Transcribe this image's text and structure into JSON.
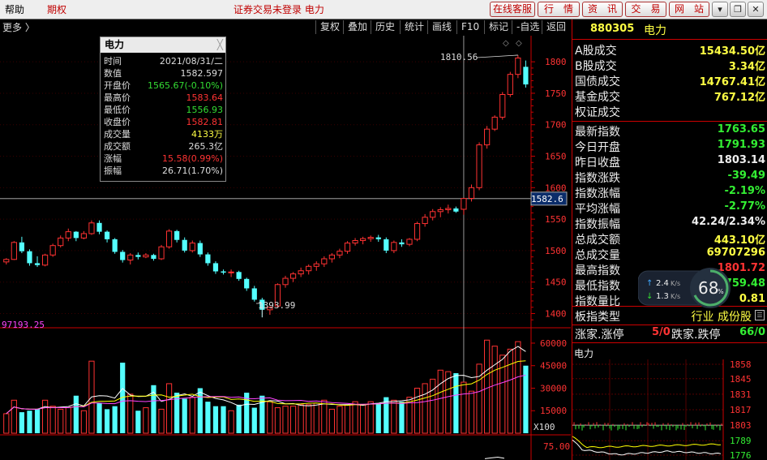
{
  "menubar": {
    "help": "帮助",
    "futures": "期权",
    "title": "证券交易未登录 电力",
    "buttons": [
      "在线客服",
      "行　情",
      "资　讯",
      "交　易",
      "网　站"
    ],
    "window_controls": [
      "▾",
      "❐",
      "✕"
    ]
  },
  "toolbar": {
    "more": "更多 〉",
    "buttons": [
      "复权",
      "叠加",
      "历史",
      "统计",
      "画线",
      "F10",
      "标记",
      "-自选",
      "返回"
    ]
  },
  "chart_labels": {
    "high_marker": "1810.56",
    "low_marker": "1393.99",
    "current_price_tag": "1582.6",
    "volume_ma": "97193.25",
    "volume_unit": "X100",
    "bottom_axis_value": "75.00"
  },
  "popup": {
    "title": "电力",
    "close": "╳",
    "rows": [
      {
        "label": "时间",
        "value": "2021/08/31/二",
        "color": "#dddddd"
      },
      {
        "label": "数值",
        "value": "1582.597",
        "color": "#dddddd"
      },
      {
        "label": "开盘价",
        "value": "1565.67(-0.10%)",
        "color": "#33dd33"
      },
      {
        "label": "最高价",
        "value": "1583.64",
        "color": "#ff3333"
      },
      {
        "label": "最低价",
        "value": "1556.93",
        "color": "#33dd33"
      },
      {
        "label": "收盘价",
        "value": "1582.81",
        "color": "#ff3333"
      },
      {
        "label": "成交量",
        "value": "4133万",
        "color": "#ffff44"
      },
      {
        "label": "成交额",
        "value": "265.3亿",
        "color": "#dddddd"
      },
      {
        "label": "涨幅",
        "value": "15.58(0.99%)",
        "color": "#ff3333"
      },
      {
        "label": "振幅",
        "value": "26.71(1.70%)",
        "color": "#dddddd"
      }
    ]
  },
  "right_panel": {
    "code": "880305",
    "name": "电力",
    "market_rows": [
      {
        "label": "A股成交",
        "value": "15434.50亿",
        "color": "#ffff44"
      },
      {
        "label": "B股成交",
        "value": "3.34亿",
        "color": "#ffff44"
      },
      {
        "label": "国债成交",
        "value": "14767.41亿",
        "color": "#ffff44"
      },
      {
        "label": "基金成交",
        "value": "767.12亿",
        "color": "#ffff44"
      },
      {
        "label": "权证成交",
        "value": "",
        "color": "#ffff44"
      }
    ],
    "index_rows": [
      {
        "label": "最新指数",
        "value": "1763.65",
        "color": "#33ee33"
      },
      {
        "label": "今日开盘",
        "value": "1791.93",
        "color": "#33ee33"
      },
      {
        "label": "昨日收盘",
        "value": "1803.14",
        "color": "#eeeeee"
      },
      {
        "label": "指数涨跌",
        "value": "-39.49",
        "color": "#33ee33"
      },
      {
        "label": "指数涨幅",
        "value": "-2.19%",
        "color": "#33ee33"
      },
      {
        "label": "平均涨幅",
        "value": "-2.77%",
        "color": "#33ee33"
      },
      {
        "label": "指数振幅",
        "value": "42.24/2.34%",
        "color": "#eeeeee"
      },
      {
        "label": "总成交额",
        "value": "443.10亿",
        "color": "#ffff44"
      },
      {
        "label": "总成交量",
        "value": "69707296",
        "color": "#ffff44"
      },
      {
        "label": "最高指数",
        "value": "1801.72",
        "color": "#ff3333"
      },
      {
        "label": "最低指数",
        "value": "1759.48",
        "color": "#33ee33"
      },
      {
        "label": "指数量比",
        "value": "0.81",
        "color": "#ffff44"
      }
    ],
    "sector": {
      "label": "板指类型",
      "value": "行业 成份股",
      "value_color": "#ffff44"
    },
    "updown": {
      "up_label": "涨家.涨停",
      "up_value": "5/0",
      "down_label": "跌家.跌停",
      "down_value": "66/0",
      "up_color": "#ff3333",
      "down_color": "#33ee33"
    },
    "mini_chart": {
      "title": "电力",
      "ticks": [
        "1858",
        "1845",
        "1831",
        "1817",
        "1803",
        "1789",
        "1776"
      ],
      "prev_close": 1803
    }
  },
  "net_widget": {
    "upload": "2.4",
    "upload_unit": "K/s",
    "download": "1.3",
    "download_unit": "K/s",
    "percent": "68",
    "percent_sign": "%"
  },
  "chart_data": {
    "type": "candlestick",
    "price_axis": {
      "ticks": [
        1800,
        1750,
        1700,
        1650,
        1600,
        1550,
        1500,
        1450,
        1400
      ],
      "range": [
        1380,
        1835
      ]
    },
    "volume_axis": {
      "ticks": [
        60000,
        45000,
        30000,
        15000
      ],
      "range": [
        0,
        67000
      ],
      "unit": "X100"
    },
    "crosshair_price": 1582.6,
    "candles": [
      [
        1482,
        1488,
        1478,
        1486
      ],
      [
        1486,
        1515,
        1485,
        1513
      ],
      [
        1513,
        1522,
        1496,
        1499
      ],
      [
        1499,
        1502,
        1476,
        1480
      ],
      [
        1480,
        1491,
        1474,
        1477
      ],
      [
        1477,
        1495,
        1475,
        1493
      ],
      [
        1493,
        1511,
        1490,
        1508
      ],
      [
        1508,
        1524,
        1505,
        1520
      ],
      [
        1520,
        1535,
        1515,
        1530
      ],
      [
        1530,
        1531,
        1515,
        1520
      ],
      [
        1520,
        1531,
        1518,
        1527
      ],
      [
        1527,
        1548,
        1525,
        1544
      ],
      [
        1544,
        1548,
        1526,
        1530
      ],
      [
        1530,
        1532,
        1513,
        1518
      ],
      [
        1518,
        1520,
        1495,
        1498
      ],
      [
        1498,
        1501,
        1481,
        1485
      ],
      [
        1485,
        1496,
        1478,
        1493
      ],
      [
        1493,
        1497,
        1486,
        1490
      ],
      [
        1490,
        1496,
        1488,
        1493
      ],
      [
        1493,
        1495,
        1484,
        1487
      ],
      [
        1487,
        1509,
        1485,
        1506
      ],
      [
        1506,
        1534,
        1503,
        1531
      ],
      [
        1531,
        1533,
        1513,
        1517
      ],
      [
        1517,
        1521,
        1497,
        1500
      ],
      [
        1500,
        1516,
        1497,
        1512
      ],
      [
        1512,
        1516,
        1490,
        1494
      ],
      [
        1494,
        1497,
        1476,
        1480
      ],
      [
        1480,
        1483,
        1463,
        1467
      ],
      [
        1467,
        1470,
        1462,
        1465
      ],
      [
        1465,
        1470,
        1458,
        1466
      ],
      [
        1466,
        1468,
        1452,
        1455
      ],
      [
        1455,
        1457,
        1436,
        1440
      ],
      [
        1440,
        1444,
        1419,
        1422
      ],
      [
        1422,
        1425,
        1394,
        1406
      ],
      [
        1406,
        1411,
        1398,
        1410
      ],
      [
        1412,
        1448,
        1409,
        1446
      ],
      [
        1446,
        1460,
        1441,
        1456
      ],
      [
        1456,
        1466,
        1450,
        1463
      ],
      [
        1463,
        1473,
        1458,
        1468
      ],
      [
        1468,
        1478,
        1462,
        1475
      ],
      [
        1475,
        1483,
        1468,
        1479
      ],
      [
        1479,
        1491,
        1474,
        1487
      ],
      [
        1487,
        1496,
        1481,
        1493
      ],
      [
        1493,
        1503,
        1488,
        1499
      ],
      [
        1499,
        1515,
        1495,
        1512
      ],
      [
        1512,
        1520,
        1508,
        1516
      ],
      [
        1516,
        1522,
        1510,
        1519
      ],
      [
        1519,
        1524,
        1514,
        1521
      ],
      [
        1521,
        1525,
        1514,
        1518
      ],
      [
        1518,
        1521,
        1496,
        1500
      ],
      [
        1500,
        1516,
        1496,
        1513
      ],
      [
        1513,
        1518,
        1506,
        1510
      ],
      [
        1510,
        1520,
        1507,
        1518
      ],
      [
        1518,
        1546,
        1515,
        1543
      ],
      [
        1543,
        1558,
        1538,
        1553
      ],
      [
        1553,
        1566,
        1548,
        1562
      ],
      [
        1562,
        1569,
        1553,
        1565
      ],
      [
        1565,
        1573,
        1559,
        1567
      ],
      [
        1567,
        1570,
        1560,
        1562
      ],
      [
        1565.67,
        1583.64,
        1556.93,
        1582.81
      ],
      [
        1583,
        1605,
        1578,
        1600
      ],
      [
        1600,
        1672,
        1596,
        1668
      ],
      [
        1668,
        1698,
        1662,
        1693
      ],
      [
        1693,
        1715,
        1690,
        1712
      ],
      [
        1712,
        1752,
        1708,
        1748
      ],
      [
        1748,
        1784,
        1744,
        1780
      ],
      [
        1780,
        1810.56,
        1774,
        1806
      ],
      [
        1792,
        1802,
        1759,
        1764
      ]
    ],
    "volumes": [
      13000,
      22000,
      14000,
      15000,
      16000,
      22000,
      18000,
      16000,
      17000,
      25000,
      15000,
      48000,
      20000,
      16000,
      18000,
      47000,
      26000,
      15000,
      17000,
      32000,
      16000,
      33000,
      27000,
      23000,
      24000,
      30000,
      21000,
      18000,
      18000,
      15000,
      19000,
      27000,
      17000,
      25000,
      21000,
      17000,
      18000,
      18000,
      19000,
      19000,
      20000,
      22000,
      16000,
      18000,
      19000,
      21000,
      19000,
      21000,
      20000,
      24000,
      22000,
      21000,
      24000,
      30000,
      33000,
      36000,
      42000,
      41000,
      40000,
      34000,
      28000,
      46000,
      62000,
      58000,
      52000,
      56000,
      61000,
      45000
    ]
  }
}
